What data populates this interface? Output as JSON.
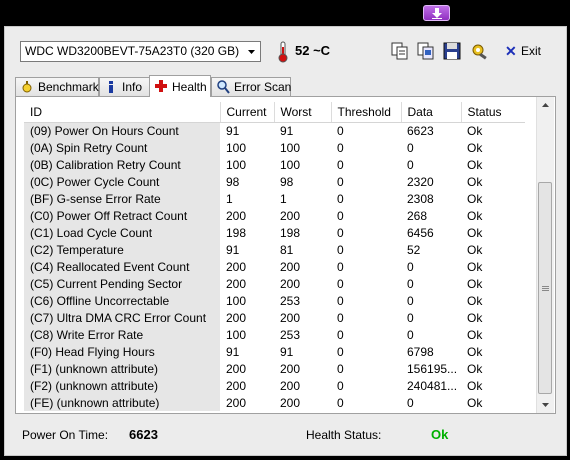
{
  "drive": {
    "selected": "WDC WD3200BEVT-75A23T0 (320 GB)"
  },
  "temperature": {
    "value": "52 ~C"
  },
  "toolbar": {
    "exit_label": "Exit"
  },
  "tabs": [
    {
      "label": "Benchmark",
      "icon": "benchmark-icon",
      "active": false
    },
    {
      "label": "Info",
      "icon": "info-icon",
      "active": false
    },
    {
      "label": "Health",
      "icon": "health-icon",
      "active": true
    },
    {
      "label": "Error Scan",
      "icon": "magnifier-icon",
      "active": false
    }
  ],
  "table": {
    "columns": [
      "ID",
      "Current",
      "Worst",
      "Threshold",
      "Data",
      "Status"
    ],
    "rows": [
      [
        "(09) Power On Hours Count",
        "91",
        "91",
        "0",
        "6623",
        "Ok"
      ],
      [
        "(0A) Spin Retry Count",
        "100",
        "100",
        "0",
        "0",
        "Ok"
      ],
      [
        "(0B) Calibration Retry Count",
        "100",
        "100",
        "0",
        "0",
        "Ok"
      ],
      [
        "(0C) Power Cycle Count",
        "98",
        "98",
        "0",
        "2320",
        "Ok"
      ],
      [
        "(BF) G-sense Error Rate",
        "1",
        "1",
        "0",
        "2308",
        "Ok"
      ],
      [
        "(C0) Power Off Retract Count",
        "200",
        "200",
        "0",
        "268",
        "Ok"
      ],
      [
        "(C1) Load Cycle Count",
        "198",
        "198",
        "0",
        "6456",
        "Ok"
      ],
      [
        "(C2) Temperature",
        "91",
        "81",
        "0",
        "52",
        "Ok"
      ],
      [
        "(C4) Reallocated Event Count",
        "200",
        "200",
        "0",
        "0",
        "Ok"
      ],
      [
        "(C5) Current Pending Sector",
        "200",
        "200",
        "0",
        "0",
        "Ok"
      ],
      [
        "(C6) Offline Uncorrectable",
        "100",
        "253",
        "0",
        "0",
        "Ok"
      ],
      [
        "(C7) Ultra DMA CRC Error Count",
        "200",
        "200",
        "0",
        "0",
        "Ok"
      ],
      [
        "(C8) Write Error Rate",
        "100",
        "253",
        "0",
        "0",
        "Ok"
      ],
      [
        "(F0) Head Flying Hours",
        "91",
        "91",
        "0",
        "6798",
        "Ok"
      ],
      [
        "(F1) (unknown attribute)",
        "200",
        "200",
        "0",
        "156195...",
        "Ok"
      ],
      [
        "(F2) (unknown attribute)",
        "200",
        "200",
        "0",
        "240481...",
        "Ok"
      ],
      [
        "(FE) (unknown attribute)",
        "200",
        "200",
        "0",
        "0",
        "Ok"
      ]
    ]
  },
  "status": {
    "power_on_label": "Power On Time:",
    "power_on_value": "6623",
    "health_label": "Health Status:",
    "health_value": "Ok",
    "health_color": "#00b000"
  }
}
